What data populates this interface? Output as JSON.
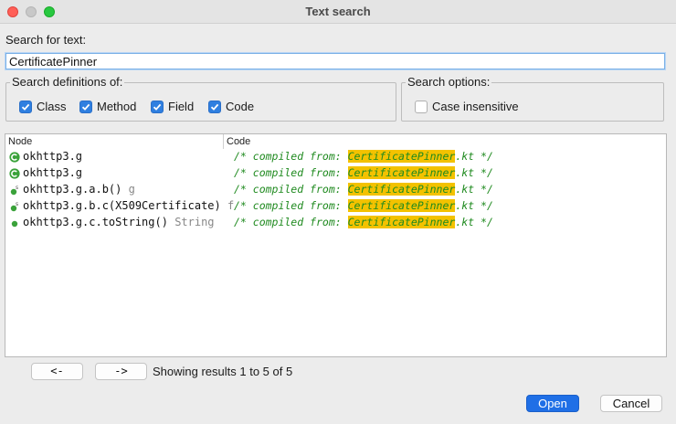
{
  "window": {
    "title": "Text search"
  },
  "search": {
    "label": "Search for text:",
    "value": "CertificatePinner"
  },
  "definitions": {
    "legend": "Search definitions of:",
    "options": [
      {
        "label": "Class",
        "checked": true
      },
      {
        "label": "Method",
        "checked": true
      },
      {
        "label": "Field",
        "checked": true
      },
      {
        "label": "Code",
        "checked": true
      }
    ]
  },
  "search_options": {
    "legend": "Search options:",
    "case_insensitive": {
      "label": "Case insensitive",
      "checked": false
    }
  },
  "results": {
    "columns": {
      "node": "Node",
      "code": "Code"
    },
    "rows": [
      {
        "icon": "class-icon",
        "node": "okhttp3.g",
        "type": "",
        "code_prefix": "/* compiled from: ",
        "code_match": "CertificatePinner",
        "code_suffix": ".kt */"
      },
      {
        "icon": "class-icon",
        "node": "okhttp3.g",
        "type": "",
        "code_prefix": "/* compiled from: ",
        "code_match": "CertificatePinner",
        "code_suffix": ".kt */"
      },
      {
        "icon": "static-method-icon",
        "node": "okhttp3.g.a.b()",
        "type": "g",
        "code_prefix": "/* compiled from: ",
        "code_match": "CertificatePinner",
        "code_suffix": ".kt */"
      },
      {
        "icon": "static-method-icon",
        "node": "okhttp3.g.b.c(X509Certificate)",
        "type": "f",
        "code_prefix": "/* compiled from: ",
        "code_match": "CertificatePinner",
        "code_suffix": ".kt */"
      },
      {
        "icon": "method-icon",
        "node": "okhttp3.g.c.toString()",
        "type": "String",
        "code_prefix": "/* compiled from: ",
        "code_match": "CertificatePinner",
        "code_suffix": ".kt */"
      }
    ]
  },
  "pagination": {
    "prev_label": "<-",
    "next_label": "->",
    "status": "Showing results 1 to 5 of 5"
  },
  "buttons": {
    "open": "Open",
    "cancel": "Cancel"
  },
  "colors": {
    "accent": "#1f6fe6",
    "highlight": "#f3c200",
    "comment": "#1f8a1f",
    "class_icon": "#3aa23a"
  }
}
